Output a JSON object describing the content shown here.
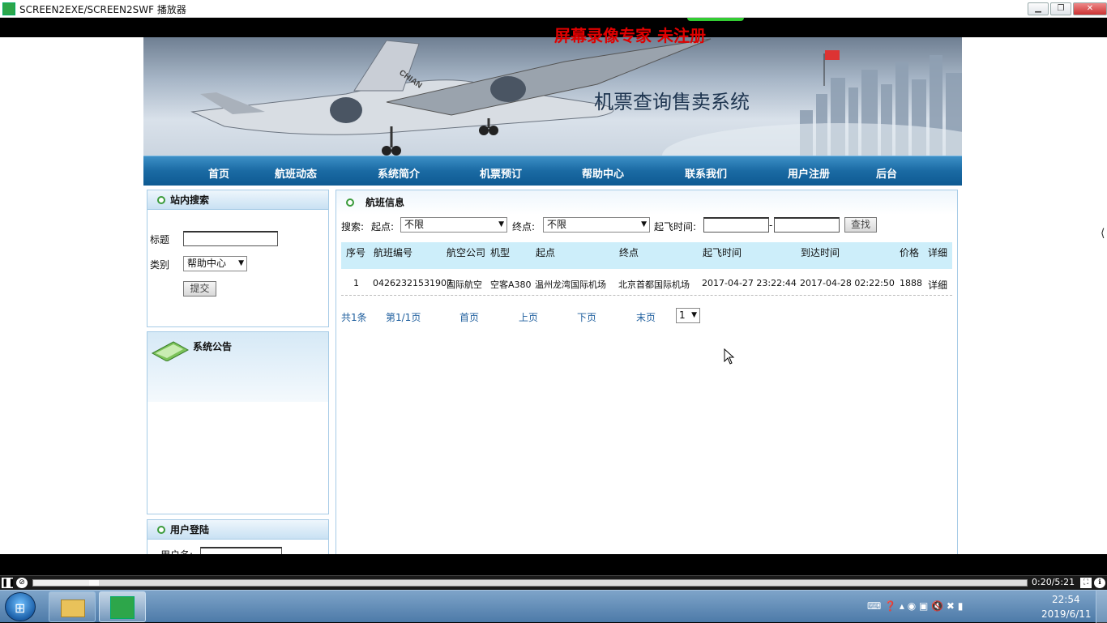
{
  "window": {
    "title": "SCREEN2EXE/SCREEN2SWF 播放器",
    "min": "▁",
    "max": "❐",
    "close": "✕"
  },
  "watermark": "屏幕录像专家  未注册",
  "banner": {
    "title": "机票查询售卖系统",
    "plane_text": "CHIAN"
  },
  "nav": [
    "首页",
    "航班动态",
    "系统简介",
    "机票预订",
    "帮助中心",
    "联系我们",
    "用户注册",
    "后台"
  ],
  "sidebar": {
    "search": {
      "title": "站内搜索",
      "title_label": "标题",
      "title_value": "",
      "category_label": "类别",
      "category_value": "帮助中心",
      "submit": "提交"
    },
    "notice": {
      "title": "系统公告"
    },
    "login": {
      "title": "用户登陆",
      "username_label": "用户名:"
    }
  },
  "main": {
    "title": "航班信息",
    "search_label": "搜索:",
    "from_label": "起点:",
    "from_value": "不限",
    "to_label": "终点:",
    "to_value": "不限",
    "time_label": "起飞时间:",
    "time_sep": "-",
    "find_button": "查找",
    "columns": [
      "序号",
      "航班编号",
      "航空公司",
      "机型",
      "起点",
      "终点",
      "起飞时间",
      "到达时间",
      "价格",
      "详细"
    ],
    "rows": [
      {
        "no": "1",
        "flight": "04262321531907",
        "airline": "国际航空",
        "model": "空客A380",
        "from": "温州龙湾国际机场",
        "to": "北京首都国际机场",
        "depart": "2017-04-27  23:22:44",
        "arrive": "2017-04-28  02:22:50",
        "price": "1888",
        "detail": "详细"
      }
    ],
    "pager": {
      "total": "共1条",
      "page": "第1/1页",
      "first": "首页",
      "prev": "上页",
      "next": "下页",
      "last": "末页",
      "select": "1"
    }
  },
  "player": {
    "time": "0:20/5:21",
    "progress": 0.066
  },
  "taskbar": {
    "time": "22:54",
    "date": "2019/6/11"
  }
}
